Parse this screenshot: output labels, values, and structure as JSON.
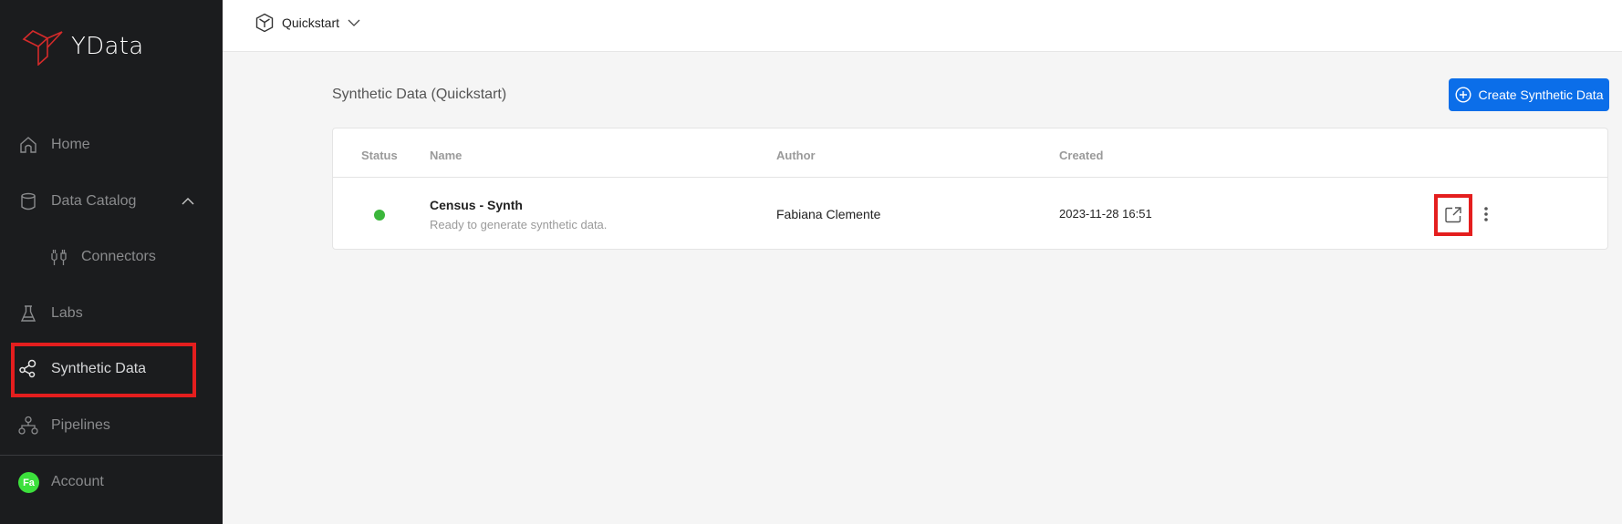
{
  "sidebar": {
    "logo_text": "YData",
    "items": [
      {
        "label": "Home",
        "icon": "home-icon"
      },
      {
        "label": "Data Catalog",
        "icon": "database-icon",
        "expanded": true
      },
      {
        "label": "Connectors",
        "icon": "plug-icon"
      },
      {
        "label": "Labs",
        "icon": "flask-icon"
      },
      {
        "label": "Synthetic Data",
        "icon": "share-nodes-icon",
        "active": true
      },
      {
        "label": "Pipelines",
        "icon": "pipeline-icon"
      }
    ],
    "account": {
      "label": "Account",
      "avatar_initials": "Fa",
      "avatar_color": "#3ce03c"
    }
  },
  "header": {
    "project": "Quickstart"
  },
  "main": {
    "title": "Synthetic Data (Quickstart)",
    "create_button": "Create Synthetic Data",
    "accent_color": "#0b6ee9",
    "table": {
      "columns": [
        "Status",
        "Name",
        "Author",
        "Created"
      ],
      "rows": [
        {
          "status": "ready",
          "status_color": "#3bb63b",
          "name": "Census - Synth",
          "description": "Ready to generate synthetic data.",
          "author": "Fabiana Clemente",
          "created": "2023-11-28 16:51"
        }
      ]
    }
  }
}
